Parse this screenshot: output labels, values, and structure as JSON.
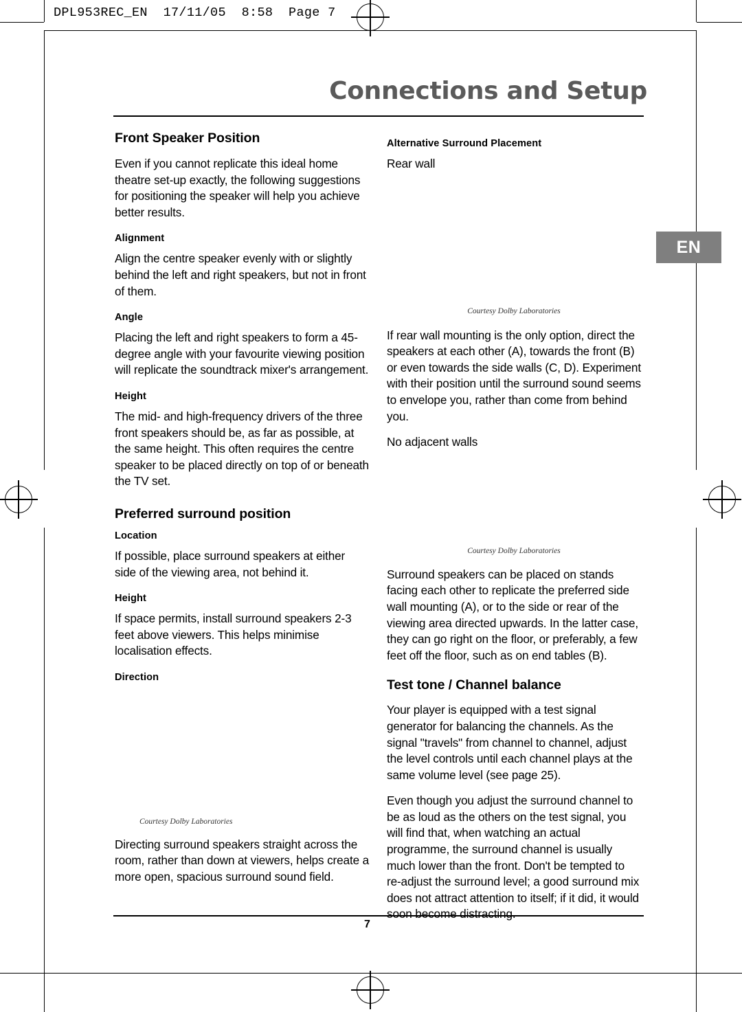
{
  "file_header": "DPL953REC_EN  17/11/05  8:58  Page 7",
  "chapter_title": "Connections and Setup",
  "language_tab": "EN",
  "page_number": "7",
  "left_column": {
    "heading1": "Front Speaker Position",
    "intro": "Even if you cannot replicate this ideal home theatre set-up exactly, the following suggestions for positioning the speaker will help you achieve better results.",
    "sub_alignment": "Alignment",
    "alignment_text": "Align the centre speaker evenly with or slightly behind the left and right speakers, but not in front of them.",
    "sub_angle": "Angle",
    "angle_text": "Placing the left and right speakers to form a 45-degree angle with your favourite viewing position will replicate the soundtrack mixer's arrangement.",
    "sub_height1": "Height",
    "height1_text": "The mid- and high-frequency drivers of the three front speakers should be, as far as possible, at the same height. This often requires the centre speaker to be placed directly on top of or beneath the TV set.",
    "heading2": "Preferred surround position",
    "sub_location": "Location",
    "location_text": "If possible, place surround speakers at either side of the viewing area, not behind it.",
    "sub_height2": "Height",
    "height2_text": "If space permits, install surround speakers 2-3 feet above viewers. This helps minimise localisation effects.",
    "sub_direction": "Direction",
    "figure_caption": "Courtesy Dolby Laboratories",
    "direction_text": "Directing surround speakers straight across the room, rather than down at viewers, helps create a more open, spacious surround sound field."
  },
  "right_column": {
    "sub_alt_surround": "Alternative Surround Placement",
    "rear_wall_label": "Rear wall",
    "figure_caption1": "Courtesy Dolby Laboratories",
    "rear_wall_text": "If rear wall mounting is the only option, direct the speakers at each other (A), towards the front (B) or even towards the side walls (C, D). Experiment with their position until the surround sound seems to envelope you, rather than come from behind you.",
    "no_adjacent_label": "No adjacent walls",
    "figure_caption2": "Courtesy Dolby Laboratories",
    "stands_text": "Surround speakers can be placed on stands facing each other to replicate the preferred side wall mounting (A), or to the side or rear of the viewing area directed upwards. In the latter case, they can go right on the floor, or preferably, a few feet off the floor, such as on end tables (B).",
    "heading_test_tone": "Test tone / Channel balance",
    "test_tone_text1": "Your player is equipped with a test signal generator for balancing the channels. As the signal \"travels\" from channel to channel, adjust the level controls until each channel plays at the same volume level (see page 25).",
    "test_tone_text2": "Even though you adjust the surround channel to be as loud as the others on the test signal, you will find that, when watching an actual programme, the surround channel is usually much lower than the front. Don't be tempted to re-adjust the surround level; a good surround mix does not attract attention to itself; if it did, it would soon become distracting."
  }
}
